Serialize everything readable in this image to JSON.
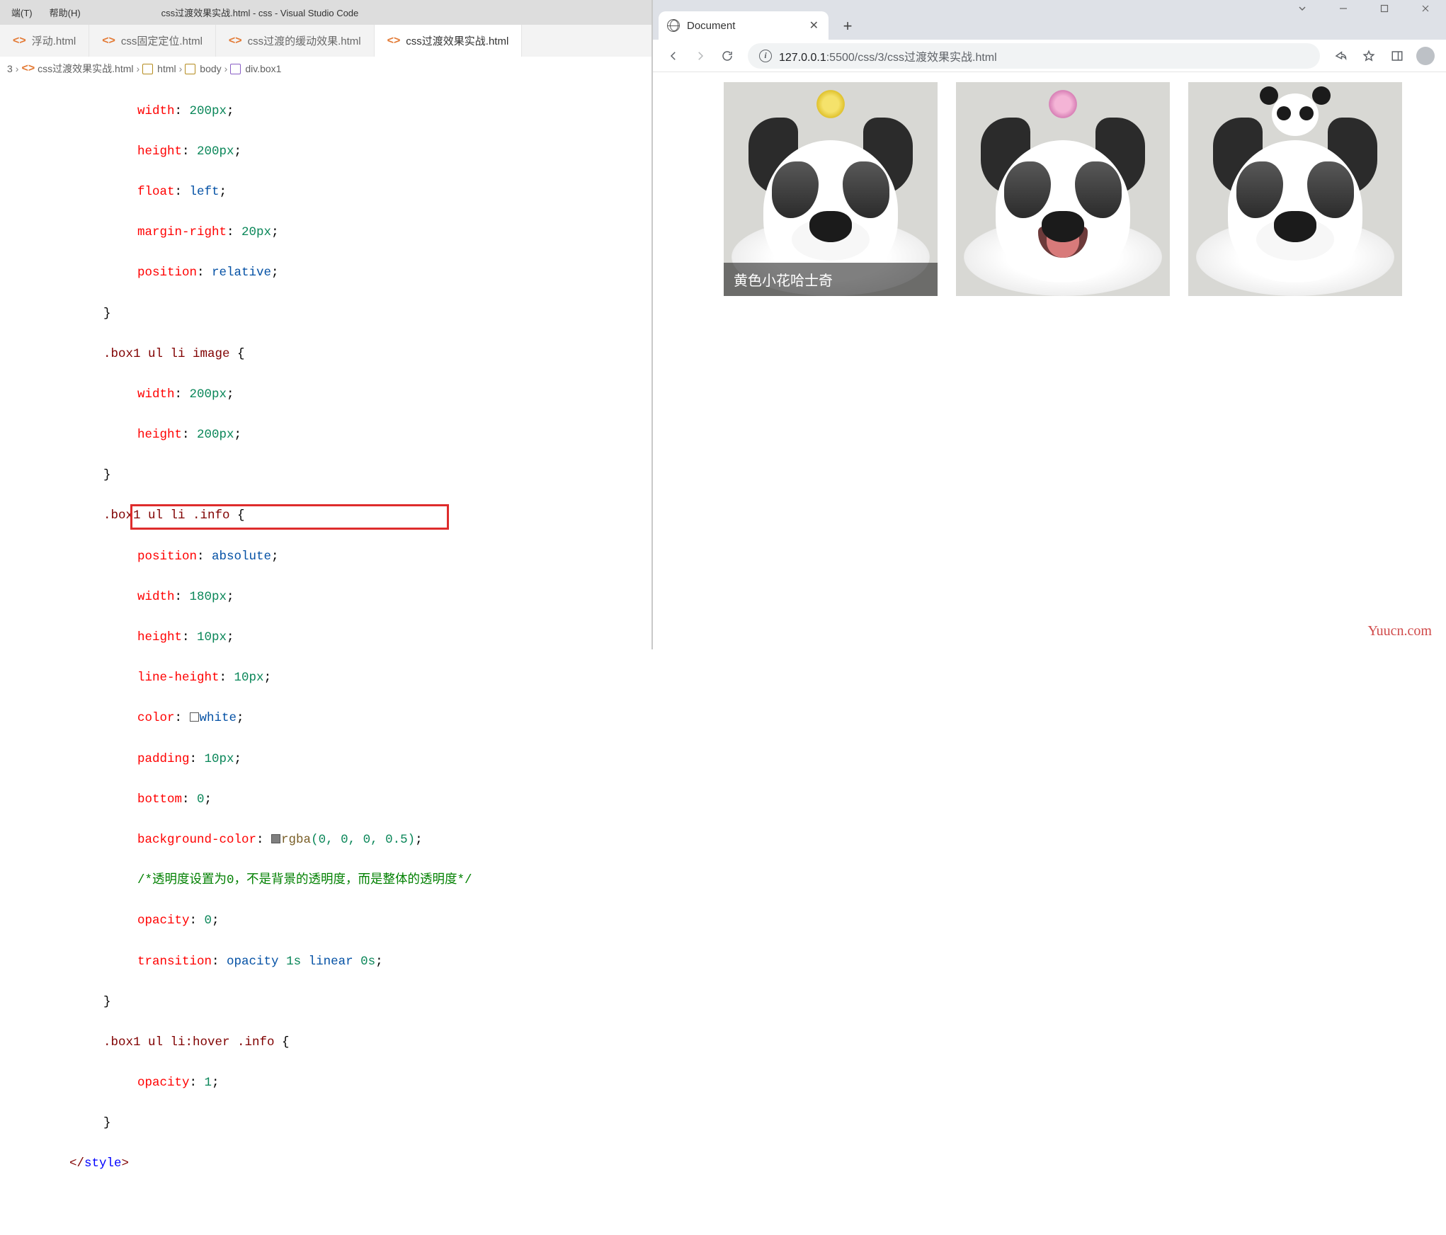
{
  "vscode": {
    "menu": {
      "terminal": "端(T)",
      "help": "帮助(H)"
    },
    "title": "css过渡效果实战.html - css - Visual Studio Code",
    "tabs": [
      {
        "label": "浮动.html",
        "active": false
      },
      {
        "label": "css固定定位.html",
        "active": false
      },
      {
        "label": "css过渡的缓动效果.html",
        "active": false
      },
      {
        "label": "css过渡效果实战.html",
        "active": true
      }
    ],
    "crumbs": [
      "3",
      "css过渡效果实战.html",
      "html",
      "body",
      "div.box1"
    ],
    "code": {
      "l1": "width",
      "l1v": "200px",
      "l2": "height",
      "l2v": "200px",
      "l3": "float",
      "l3v": "left",
      "l4": "margin-right",
      "l4v": "20px",
      "l5": "position",
      "l5v": "relative",
      "sel2": ".box1 ul li image {",
      "l6": "width",
      "l6v": "200px",
      "l7": "height",
      "l7v": "200px",
      "sel3": ".box1 ul li .info {",
      "l8": "position",
      "l8v": "absolute",
      "l9": "width",
      "l9v": "180px",
      "l10": "height",
      "l10v": "10px",
      "l11": "line-height",
      "l11v": "10px",
      "l12": "color",
      "l12v": "white",
      "l13": "padding",
      "l13v": "10px",
      "l14": "bottom",
      "l14v": "0",
      "l15": "background-color",
      "l15fn": "rgba",
      "l15a": "(0, 0, 0, 0.5)",
      "cmt": "/*透明度设置为0，不是背景的透明度，而是整体的透明度*/",
      "l16": "opacity",
      "l16v": "0",
      "l17": "transition",
      "l17v": "opacity 1s linear 0s",
      "sel4": ".box1 ul li:hover .info {",
      "l18": "opacity",
      "l18v": "1",
      "close": "</style>"
    }
  },
  "chrome": {
    "tabTitle": "Document",
    "url_host": "127.0.0.1",
    "url_port": ":5500",
    "url_path": "/css/3/css过渡效果实战.html",
    "caption1": "黄色小花哈士奇",
    "watermark": "Yuucn.com"
  }
}
